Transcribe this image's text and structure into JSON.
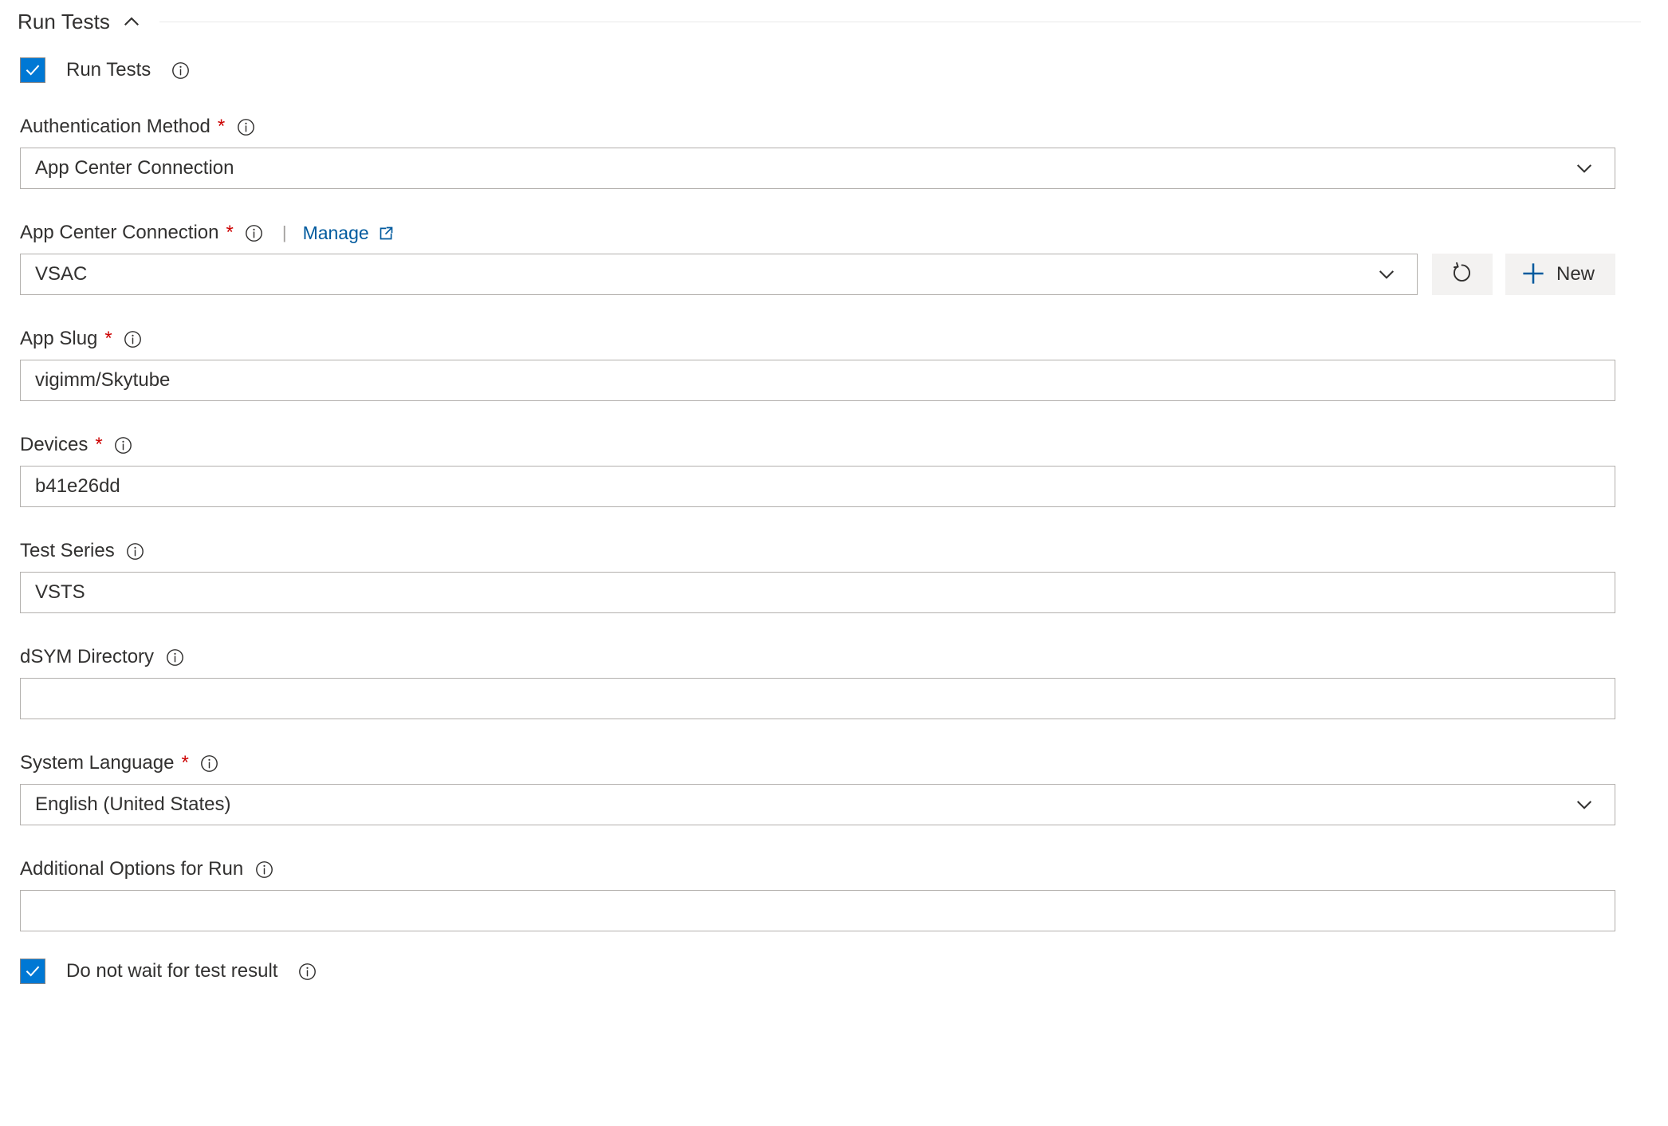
{
  "section": {
    "title": "Run Tests",
    "collapse_icon": "chevron-up-icon",
    "expanded": true
  },
  "run_tests_checkbox": {
    "label": "Run Tests",
    "checked": true,
    "info_icon": "info-icon"
  },
  "fields": {
    "authentication_method": {
      "label": "Authentication Method",
      "required": true,
      "info_icon": "info-icon",
      "type": "select",
      "value": "App Center Connection",
      "chevron_icon": "chevron-down-icon"
    },
    "app_center_connection": {
      "label": "App Center Connection",
      "required": true,
      "info_icon": "info-icon",
      "separator": "|",
      "manage_label": "Manage",
      "manage_icon": "external-link-icon",
      "type": "select",
      "value": "VSAC",
      "chevron_icon": "chevron-down-icon",
      "refresh_icon": "refresh-icon",
      "new_label": "New",
      "new_icon": "plus-icon"
    },
    "app_slug": {
      "label": "App Slug",
      "required": true,
      "info_icon": "info-icon",
      "type": "text",
      "value": "vigimm/Skytube",
      "placeholder": ""
    },
    "devices": {
      "label": "Devices",
      "required": true,
      "info_icon": "info-icon",
      "type": "text",
      "value": "b41e26dd",
      "placeholder": ""
    },
    "test_series": {
      "label": "Test Series",
      "required": false,
      "info_icon": "info-icon",
      "type": "text",
      "value": "VSTS",
      "placeholder": ""
    },
    "dsym_directory": {
      "label": "dSYM Directory",
      "required": false,
      "info_icon": "info-icon",
      "type": "text",
      "value": "",
      "placeholder": ""
    },
    "system_language": {
      "label": "System Language",
      "required": true,
      "info_icon": "info-icon",
      "type": "select",
      "value": "English (United States)",
      "chevron_icon": "chevron-down-icon"
    },
    "additional_options": {
      "label": "Additional Options for Run",
      "required": false,
      "info_icon": "info-icon",
      "type": "text",
      "value": "",
      "placeholder": ""
    }
  },
  "do_not_wait_checkbox": {
    "label": "Do not wait for test result",
    "checked": true,
    "info_icon": "info-icon"
  },
  "colors": {
    "accent": "#0078d4",
    "link": "#005a9e",
    "required": "#cc0000",
    "text": "#323130",
    "border": "#b3b0ad",
    "button_bg": "#f3f2f1",
    "rule": "#eaeaea"
  }
}
